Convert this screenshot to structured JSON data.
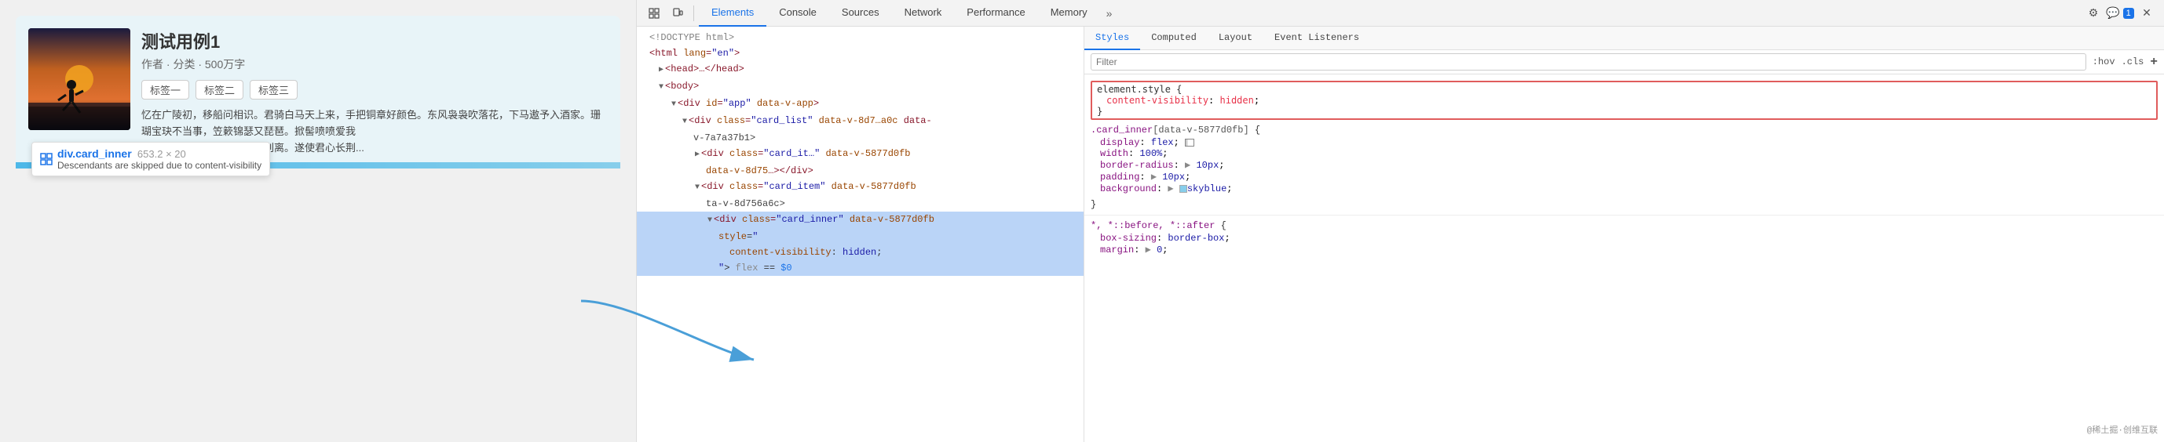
{
  "webpage": {
    "card": {
      "title": "测试用例1",
      "subtitle": "作者 · 分类 · 500万字",
      "tags": [
        "标签一",
        "标签二",
        "标签三"
      ],
      "text": "忆在广陵初，移船问相识。君骑白马天上来，手把铜章好颜色。东风袅袅吹落花，下马遨予入酒家。珊瑚宝玦不当事，笠簌锦瑟又琵琶。掀髻喷喷爱我",
      "text2": "时我尚有妻子，到家不肯轻别离。遂使君心长荆..."
    },
    "tooltip": {
      "label": "div.card_inner",
      "size": "653.2 × 20",
      "desc": "Descendants are skipped due to content-visibility"
    }
  },
  "devtools": {
    "toolbar": {
      "tabs": [
        "Elements",
        "Console",
        "Sources",
        "Network",
        "Performance",
        "Memory"
      ],
      "active_tab": "Elements",
      "more_tabs_label": "»",
      "notification_count": "1"
    },
    "dom": {
      "lines": [
        {
          "indent": 0,
          "content": "<!DOCTYPE html>"
        },
        {
          "indent": 0,
          "content": "<html lang=\"en\">"
        },
        {
          "indent": 1,
          "content": "▶ <head>…</head>"
        },
        {
          "indent": 1,
          "content": "▼ <body>"
        },
        {
          "indent": 2,
          "content": "▼ <div id=\"app\" data-v-app>"
        },
        {
          "indent": 3,
          "content": "▼ <div class=\"card_list\" data-v-8d7…a0c data-"
        },
        {
          "indent": 3,
          "content": "v-7a7a37b1>"
        },
        {
          "indent": 4,
          "content": "▶ <div class=\"card_it…\" data-v-5877d0fb"
        },
        {
          "indent": 4,
          "content": "data-v-8d75…></div>"
        },
        {
          "indent": 4,
          "content": "▼ <div class=\"card_item\" data-v-5877d0fb"
        },
        {
          "indent": 4,
          "content": "ta-v-8d756a6c>"
        },
        {
          "indent": 5,
          "content": "▼ <div class=\"card_inner\" data-v-5877d0fb"
        },
        {
          "indent": 5,
          "content": "style=\""
        },
        {
          "indent": 6,
          "content": "content-visibility: hidden;"
        },
        {
          "indent": 5,
          "content": "\"> flex == $0"
        }
      ]
    },
    "styles": {
      "tabs": [
        "Styles",
        "Computed",
        "Layout",
        "Event Listeners"
      ],
      "active_tab": "Styles",
      "filter_placeholder": "Filter",
      "hov_label": ":hov",
      "cls_label": ".cls",
      "add_label": "+",
      "rules": [
        {
          "type": "element-style",
          "selector": "element.style {",
          "props": [
            {
              "name": "content-visibility",
              "value": "hidden",
              "highlighted": true
            }
          ],
          "close": "}"
        },
        {
          "selector": ".card_inner[data-v-5877d0fb] {",
          "props": [
            {
              "name": "display",
              "value": "flex",
              "has_icon": true
            },
            {
              "name": "width",
              "value": "100%;"
            },
            {
              "name": "border-radius",
              "value": "▶ 10px;"
            },
            {
              "name": "padding",
              "value": "▶ 10px;"
            },
            {
              "name": "background",
              "value": "▶ skyblue",
              "has_color": true,
              "color": "skyblue"
            }
          ],
          "close": "}"
        },
        {
          "selector": "*, *::before, *::after {",
          "props": [
            {
              "name": "box-sizing",
              "value": "border-box;"
            },
            {
              "name": "margin",
              "value": "▶ 0;"
            }
          ]
        }
      ]
    }
  }
}
